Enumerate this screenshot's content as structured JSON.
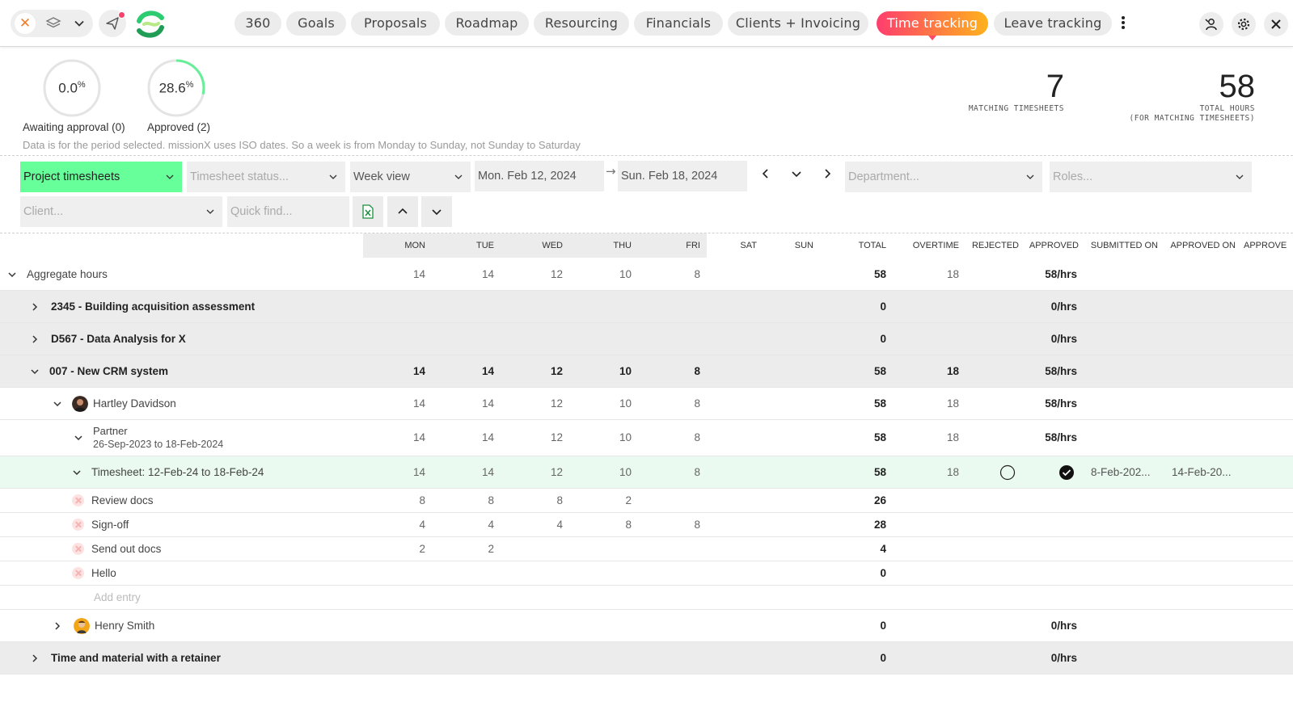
{
  "nav": {
    "items": [
      "360",
      "Goals",
      "Proposals",
      "Roadmap",
      "Resourcing",
      "Financials",
      "Clients + Invoicing",
      "Time tracking",
      "Leave tracking"
    ],
    "active": "Time tracking"
  },
  "stats": {
    "awaiting": {
      "value": "0.0",
      "unit": "%",
      "caption": "Awaiting approval (0)",
      "fraction": 0.0
    },
    "approved": {
      "value": "28.6",
      "unit": "%",
      "caption": "Approved (2)",
      "fraction": 0.286
    },
    "info": "Data is for the period selected. missionX uses ISO dates. So a week is from Monday to Sunday, not Sunday to Saturday",
    "matching_count": "7",
    "matching_label": "MATCHING TIMESHEETS",
    "total_hours": "58",
    "total_hours_label_1": "TOTAL HOURS",
    "total_hours_label_2": "(FOR MATCHING TIMESHEETS)"
  },
  "filters": {
    "project": "Project timesheets",
    "status_placeholder": "Timesheet status...",
    "view": "Week view",
    "date_from": "Mon. Feb 12, 2024",
    "arrow": "→",
    "date_to": "Sun. Feb 18, 2024",
    "department_placeholder": "Department...",
    "roles_placeholder": "Roles...",
    "client_placeholder": "Client...",
    "quick_find_placeholder": "Quick find..."
  },
  "columns": [
    "MON",
    "TUE",
    "WED",
    "THU",
    "FRI",
    "SAT",
    "SUN",
    "TOTAL",
    "OVERTIME",
    "REJECTED",
    "APPROVED",
    "SUBMITTED ON",
    "APPROVED ON",
    "APPROVE"
  ],
  "rows": {
    "aggregate": {
      "label": "Aggregate hours",
      "mon": "14",
      "tue": "14",
      "wed": "12",
      "thu": "10",
      "fri": "8",
      "total": "58",
      "overtime": "18",
      "approved": "58/hrs"
    },
    "p1": {
      "label": "2345 - Building acquisition assessment",
      "total": "0",
      "approved": "0/hrs"
    },
    "p2": {
      "label": "D567 - Data Analysis for X",
      "total": "0",
      "approved": "0/hrs"
    },
    "p3": {
      "label": "007 - New CRM system",
      "mon": "14",
      "tue": "14",
      "wed": "12",
      "thu": "10",
      "fri": "8",
      "total": "58",
      "overtime": "18",
      "approved": "58/hrs"
    },
    "person1": {
      "label": "Hartley Davidson",
      "mon": "14",
      "tue": "14",
      "wed": "12",
      "thu": "10",
      "fri": "8",
      "total": "58",
      "overtime": "18",
      "approved": "58/hrs"
    },
    "role": {
      "label": "Partner",
      "period": "26-Sep-2023 to 18-Feb-2024",
      "mon": "14",
      "tue": "14",
      "wed": "12",
      "thu": "10",
      "fri": "8",
      "total": "58",
      "overtime": "18",
      "approved": "58/hrs"
    },
    "timesheet": {
      "label": "Timesheet:  12-Feb-24  to  18-Feb-24",
      "mon": "14",
      "tue": "14",
      "wed": "12",
      "thu": "10",
      "fri": "8",
      "total": "58",
      "overtime": "18",
      "submitted_on": "8-Feb-202...",
      "approved_on": "14-Feb-20..."
    },
    "task1": {
      "label": "Review docs",
      "mon": "8",
      "tue": "8",
      "wed": "8",
      "thu": "2",
      "total": "26"
    },
    "task2": {
      "label": "Sign-off",
      "mon": "4",
      "tue": "4",
      "wed": "4",
      "thu": "8",
      "fri": "8",
      "total": "28"
    },
    "task3": {
      "label": "Send out docs",
      "mon": "2",
      "tue": "2",
      "total": "4"
    },
    "task4": {
      "label": "Hello",
      "total": "0"
    },
    "add_entry": "Add entry",
    "person2": {
      "label": "Henry Smith",
      "total": "0",
      "approved": "0/hrs"
    },
    "p4": {
      "label": "Time and material with a retainer",
      "total": "0",
      "approved": "0/hrs"
    }
  },
  "colors": {
    "accent_from": "#ff3d6e",
    "accent_to": "#ffb21c",
    "approved_ring": "#66ee99",
    "filter_active": "#66ff99",
    "row_highlight": "#eafaf0"
  }
}
